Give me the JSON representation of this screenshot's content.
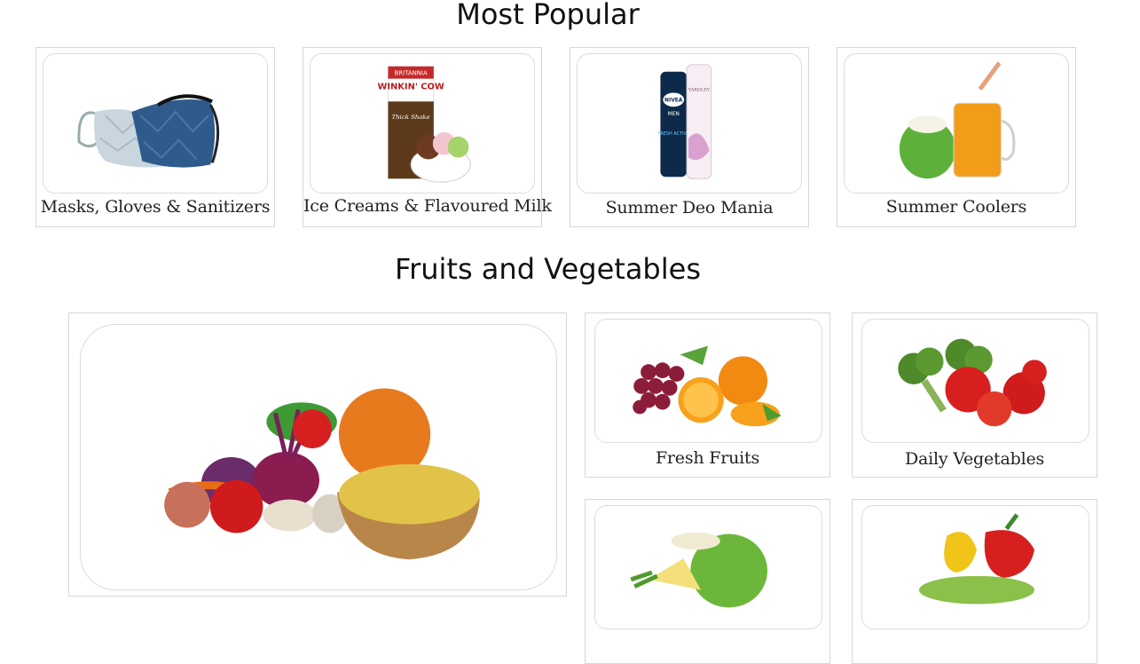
{
  "sections": {
    "most_popular": {
      "title": "Most Popular",
      "items": [
        {
          "label": "Masks, Gloves & Sanitizers",
          "image_icon": "face-masks-image"
        },
        {
          "label": "Ice Creams & Flavoured Milk",
          "image_icon": "milkshake-icecream-image",
          "package_brand": "BRITANNIA",
          "package_name": "WINKIN' COW",
          "package_sub": "Thick Shake"
        },
        {
          "label": "Summer Deo Mania",
          "image_icon": "deodorant-cans-image",
          "can1_brand": "NIVEA",
          "can1_sub": "MEN",
          "can1_variant": "FRESH ACTIVE",
          "can2_brand": "YARDLEY"
        },
        {
          "label": "Summer Coolers",
          "image_icon": "coconut-juice-image"
        }
      ]
    },
    "fruits_and_vegetables": {
      "title": "Fruits and Vegetables",
      "hero": {
        "image_icon": "vegetables-basket-image"
      },
      "items": [
        {
          "label": "Fresh Fruits",
          "image_icon": "grapes-oranges-image"
        },
        {
          "label": "Daily Vegetables",
          "image_icon": "broccoli-tomatoes-image"
        },
        {
          "label": "",
          "image_icon": "coconut-pineapple-image"
        },
        {
          "label": "",
          "image_icon": "peppers-image"
        }
      ]
    }
  }
}
